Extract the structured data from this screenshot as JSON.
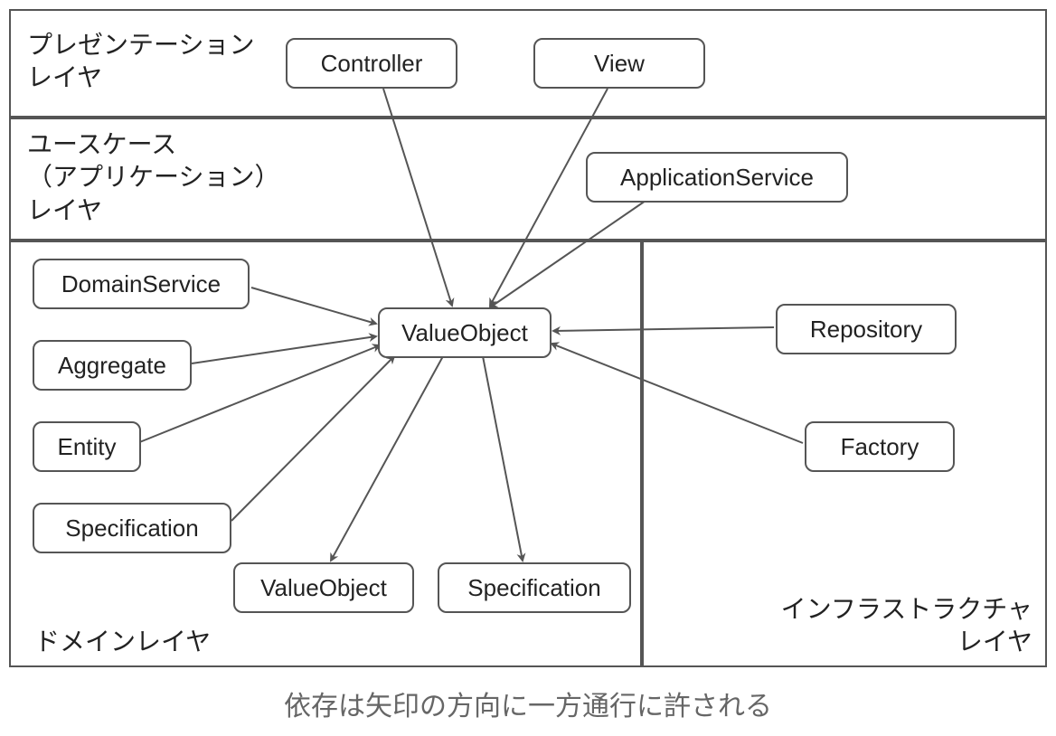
{
  "layers": {
    "presentation": {
      "label": "プレゼンテーション\nレイヤ"
    },
    "usecase": {
      "label": "ユースケース\n（アプリケーション）\nレイヤ"
    },
    "domain": {
      "label": "ドメインレイヤ"
    },
    "infra": {
      "label": "インフラストラクチャ\nレイヤ"
    }
  },
  "nodes": {
    "controller": {
      "label": "Controller"
    },
    "view": {
      "label": "View"
    },
    "applicationService": {
      "label": "ApplicationService"
    },
    "domainService": {
      "label": "DomainService"
    },
    "aggregate": {
      "label": "Aggregate"
    },
    "entity": {
      "label": "Entity"
    },
    "specification": {
      "label": "Specification"
    },
    "valueObject": {
      "label": "ValueObject"
    },
    "valueObject2": {
      "label": "ValueObject"
    },
    "specification2": {
      "label": "Specification"
    },
    "repository": {
      "label": "Repository"
    },
    "factory": {
      "label": "Factory"
    }
  },
  "caption": "依存は矢印の方向に一方通行に許される",
  "arrows": [
    {
      "from": "controller",
      "to": "valueObject"
    },
    {
      "from": "view",
      "to": "valueObject"
    },
    {
      "from": "applicationService",
      "to": "valueObject"
    },
    {
      "from": "domainService",
      "to": "valueObject"
    },
    {
      "from": "aggregate",
      "to": "valueObject"
    },
    {
      "from": "entity",
      "to": "valueObject"
    },
    {
      "from": "specification",
      "to": "valueObject"
    },
    {
      "from": "repository",
      "to": "valueObject"
    },
    {
      "from": "factory",
      "to": "valueObject"
    },
    {
      "from": "valueObject",
      "to": "valueObject2"
    },
    {
      "from": "valueObject",
      "to": "specification2"
    }
  ]
}
